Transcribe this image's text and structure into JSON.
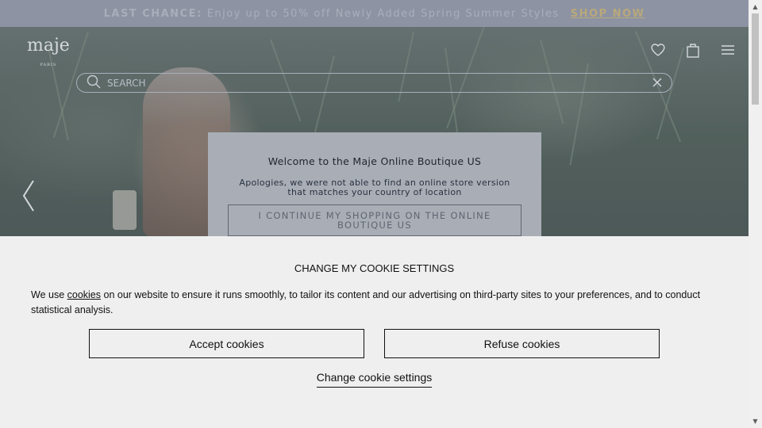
{
  "promo": {
    "strong": "LAST CHANCE:",
    "text": "Enjoy up to 50% off Newly Added Spring Summer Styles",
    "link": "SHOP NOW"
  },
  "header": {
    "logo": "maje",
    "logo_sub": "PARIS",
    "icons": [
      "heart-icon",
      "bag-icon",
      "menu-icon"
    ]
  },
  "search": {
    "placeholder": "SEARCH"
  },
  "modal": {
    "title": "Welcome to the Maje Online Boutique US",
    "description": "Apologies, we were not able to find an online store version that matches your country of location",
    "button": "I CONTINUE MY SHOPPING ON THE ONLINE BOUTIQUE US"
  },
  "cookie": {
    "title": "CHANGE MY COOKIE SETTINGS",
    "text_before": "We use ",
    "link": "cookies",
    "text_after": " on our website to ensure it runs smoothly, to tailor its content and our advertising on third-party sites to your preferences, and to conduct statistical analysis.",
    "accept": "Accept cookies",
    "refuse": "Refuse cookies",
    "change": "Change cookie settings"
  },
  "colors": {
    "overlay": "#5a6a6e",
    "cookie_bg": "#efefef",
    "modal_bg": "#a9aeb6"
  }
}
